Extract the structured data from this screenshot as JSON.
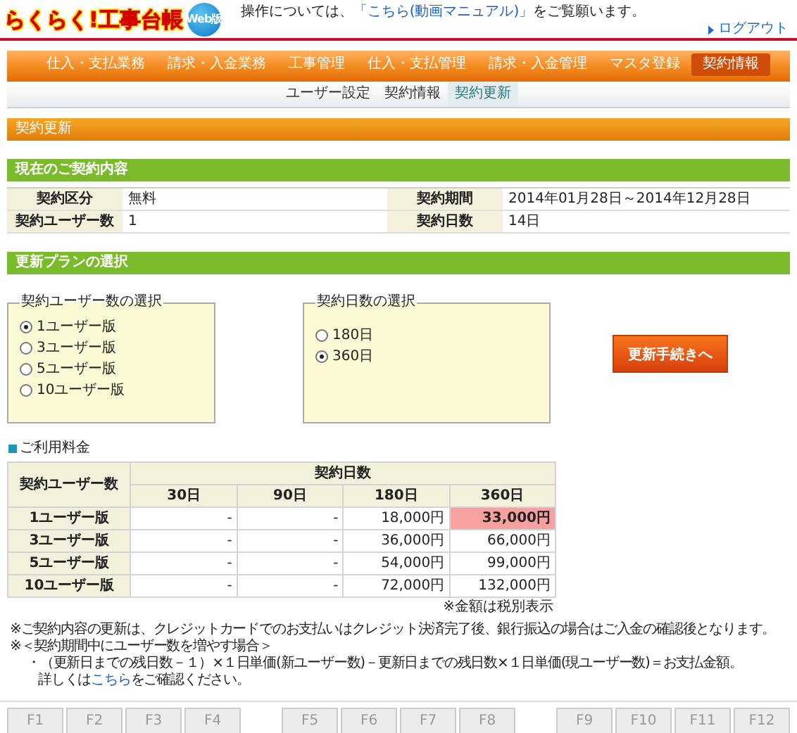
{
  "header": {
    "logo": "らくらく!工事台帳",
    "logo_badge": "Web版",
    "notice": {
      "before": "操作については、",
      "link": "「こちら(動画マニュアル)」",
      "after": "をご覧願います。"
    },
    "logout": "ログアウト"
  },
  "nav": [
    {
      "label": "仕入・支払業務",
      "selected": false
    },
    {
      "label": "請求・入金業務",
      "selected": false
    },
    {
      "label": "工事管理",
      "selected": false
    },
    {
      "label": "仕入・支払管理",
      "selected": false
    },
    {
      "label": "請求・入金管理",
      "selected": false
    },
    {
      "label": "マスタ登録",
      "selected": false
    },
    {
      "label": "契約情報",
      "selected": true
    }
  ],
  "subnav": [
    {
      "label": "ユーザー設定",
      "selected": false
    },
    {
      "label": "契約情報",
      "selected": false
    },
    {
      "label": "契約更新",
      "selected": true
    }
  ],
  "page_title": "契約更新",
  "current": {
    "title": "現在のご契約内容",
    "rows": [
      {
        "label_1": "契約区分",
        "value_1": "無料",
        "label_2": "契約期間",
        "value_2": "2014年01月28日～2014年12月28日"
      },
      {
        "label_1": "契約ユーザー数",
        "value_1": "1",
        "label_2": "契約日数",
        "value_2": "14日"
      }
    ]
  },
  "plan": {
    "title": "更新プランの選択",
    "users": {
      "legend": "契約ユーザー数の選択",
      "options": [
        {
          "label": "1ユーザー版",
          "selected": true
        },
        {
          "label": "3ユーザー版",
          "selected": false
        },
        {
          "label": "5ユーザー版",
          "selected": false
        },
        {
          "label": "10ユーザー版",
          "selected": false
        }
      ]
    },
    "days": {
      "legend": "契約日数の選択",
      "options": [
        {
          "label": "180日",
          "selected": false
        },
        {
          "label": "360日",
          "selected": true
        }
      ]
    },
    "button": "更新手続きへ"
  },
  "fees": {
    "title": "ご利用料金",
    "row_header": "契約ユーザー数",
    "group_header": "契約日数",
    "columns": [
      "30日",
      "90日",
      "180日",
      "360日"
    ],
    "rows": [
      {
        "label": "1ユーザー版",
        "cells": [
          {
            "text": "-",
            "selected": false
          },
          {
            "text": "-",
            "selected": false
          },
          {
            "text": "18,000円",
            "selected": false
          },
          {
            "text": "33,000円",
            "selected": true
          }
        ]
      },
      {
        "label": "3ユーザー版",
        "cells": [
          {
            "text": "-",
            "selected": false
          },
          {
            "text": "-",
            "selected": false
          },
          {
            "text": "36,000円",
            "selected": false
          },
          {
            "text": "66,000円",
            "selected": false
          }
        ]
      },
      {
        "label": "5ユーザー版",
        "cells": [
          {
            "text": "-",
            "selected": false
          },
          {
            "text": "-",
            "selected": false
          },
          {
            "text": "54,000円",
            "selected": false
          },
          {
            "text": "99,000円",
            "selected": false
          }
        ]
      },
      {
        "label": "10ユーザー版",
        "cells": [
          {
            "text": "-",
            "selected": false
          },
          {
            "text": "-",
            "selected": false
          },
          {
            "text": "72,000円",
            "selected": false
          },
          {
            "text": "132,000円",
            "selected": false
          }
        ]
      }
    ],
    "note": "※金額は税別表示"
  },
  "notes": [
    "※ご契約内容の更新は、クレジットカードでのお支払いはクレジット決済完了後、銀行振込の場合はご入金の確認後となります。",
    "※＜契約期間中にユーザー数を増やす場合＞"
  ],
  "formula": "・（更新日までの残日数－１）×１日単価(新ユーザー数)－更新日までの残日数×１日単価(現ユーザー数)＝お支払金額。",
  "detail": {
    "before": "詳しくは",
    "link": "こちら",
    "after": "をご確認ください。"
  },
  "function_keys": [
    {
      "label": "F1",
      "disabled": true
    },
    {
      "label": "F2",
      "disabled": true
    },
    {
      "label": "F3",
      "disabled": true
    },
    {
      "label": "F4",
      "disabled": true
    },
    {
      "label": "F5",
      "disabled": true
    },
    {
      "label": "F6",
      "disabled": true
    },
    {
      "label": "F7",
      "disabled": true
    },
    {
      "label": "F8",
      "disabled": true
    },
    {
      "label": "F9",
      "disabled": true
    },
    {
      "label": "F10",
      "disabled": true
    },
    {
      "label": "F11",
      "disabled": true
    },
    {
      "label": "F12",
      "disabled": true
    }
  ]
}
